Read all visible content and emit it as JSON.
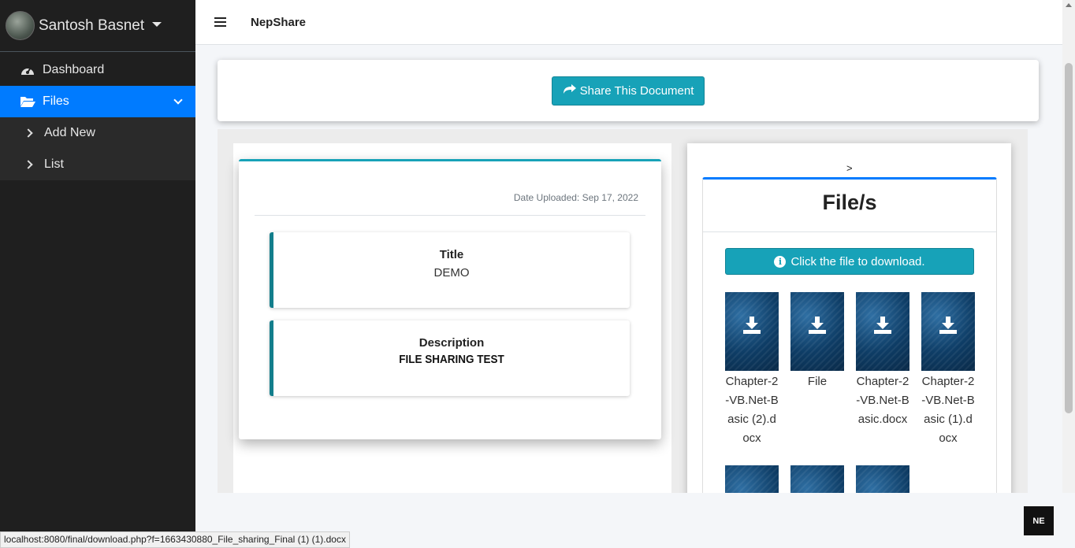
{
  "sidebar": {
    "user_name": "Santosh Basnet",
    "items": [
      {
        "label": "Dashboard",
        "icon": "tachometer-icon"
      },
      {
        "label": "Files",
        "icon": "folder-open-icon",
        "active": true
      },
      {
        "label": "Add New",
        "icon": "chevron-right-icon"
      },
      {
        "label": "List",
        "icon": "chevron-right-icon"
      }
    ]
  },
  "topbar": {
    "brand": "NepShare"
  },
  "share": {
    "button_label": "Share This Document"
  },
  "document": {
    "date_uploaded": "Date Uploaded: Sep 17, 2022",
    "title_label": "Title",
    "title_value": "DEMO",
    "description_label": "Description",
    "description_value": "FILE SHARING TEST"
  },
  "files": {
    "breadcrumb": ">",
    "heading": "File/s",
    "download_hint": "Click the file to download.",
    "items": [
      {
        "name": "Chapter-2-VB.Net-Basic (2).docx"
      },
      {
        "name": "File"
      },
      {
        "name": "Chapter-2-VB.Net-Basic.docx"
      },
      {
        "name": "Chapter-2-VB.Net-Basic (1).docx"
      }
    ]
  },
  "status_bar": {
    "url": "localhost:8080/final/download.php?f=1663430880_File_sharing_Final (1) (1).docx"
  },
  "badge": {
    "text": "NE"
  },
  "colors": {
    "accent": "#007bff",
    "teal": "#17a2b8",
    "sidebar": "#1f1f1f"
  }
}
